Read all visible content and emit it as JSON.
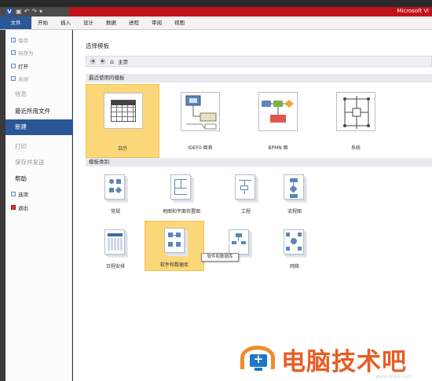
{
  "window": {
    "app_title": "Microsoft Vi"
  },
  "ribbon": {
    "tabs": [
      "文件",
      "开始",
      "插入",
      "设计",
      "数据",
      "进程",
      "审阅",
      "视图"
    ]
  },
  "backstage": {
    "items": [
      {
        "label": "保存",
        "enabled": false
      },
      {
        "label": "另存为",
        "enabled": false
      },
      {
        "label": "打开",
        "enabled": true
      },
      {
        "label": "关闭",
        "enabled": false
      }
    ],
    "info": "信息",
    "recent": "最近所用文件",
    "new": "新建",
    "print": "打印",
    "save_send": "保存并发送",
    "help": "帮助",
    "options": "选项",
    "exit": "退出"
  },
  "main": {
    "heading": "选择模板",
    "nav_label": "主页",
    "recent_section": "最近使用的模板",
    "recent_templates": [
      {
        "label": "日历",
        "icon": "calendar-icon",
        "selected": true
      },
      {
        "label": "IDEF0 图表",
        "icon": "idef0-diagram-icon",
        "selected": false
      },
      {
        "label": "BPMN 图",
        "icon": "bpmn-diagram-icon",
        "selected": false
      },
      {
        "label": "系统",
        "icon": "system-diagram-icon",
        "selected": false
      }
    ],
    "category_section": "模板类别",
    "categories": [
      {
        "label": "常规",
        "icon": "general-icon"
      },
      {
        "label": "地图和平面布置图",
        "icon": "maps-floorplans-icon"
      },
      {
        "label": "工程",
        "icon": "engineering-icon"
      },
      {
        "label": "流程图",
        "icon": "flowchart-icon"
      },
      {
        "label": "日程安排",
        "icon": "schedule-icon"
      },
      {
        "label": "软件和数据库",
        "icon": "software-database-icon"
      },
      {
        "label": "",
        "icon": "business-icon"
      },
      {
        "label": "网络",
        "icon": "network-icon"
      }
    ],
    "tooltip": "软件和数据库"
  },
  "watermark": {
    "text": "电脑技术吧",
    "url": "www.dnjsb.com"
  }
}
